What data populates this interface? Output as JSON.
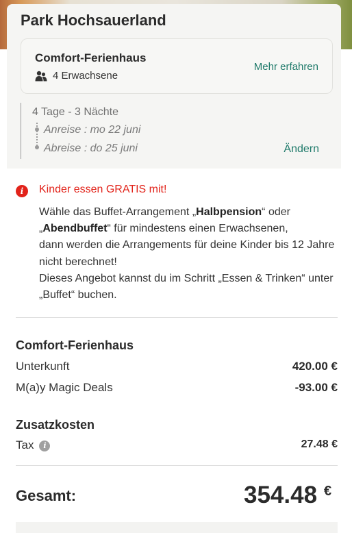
{
  "park": {
    "title": "Park Hochsauerland"
  },
  "accommodation": {
    "name": "Comfort-Ferienhaus",
    "guests": "4 Erwachsene",
    "more_link": "Mehr erfahren"
  },
  "stay": {
    "duration": "4 Tage - 3 Nächte",
    "arrival": "Anreise : mo 22 juni",
    "departure": "Abreise : do 25 juni",
    "change_link": "Ändern"
  },
  "notice": {
    "title": "Kinder essen GRATIS mit!",
    "line1_pre": "Wähle das Buffet-Arrangement „",
    "halbpension": "Halbpension",
    "line1_post": "“ oder",
    "line2_pre": "„",
    "abendbuffet": "Abendbuffet",
    "line2_post": "“ für mindestens einen Erwachsenen,",
    "line3": "dann werden die Arrangements für deine Kinder bis 12 Jahre nicht berechnet!",
    "line4": "Dieses Angebot kannst du im Schritt „Essen & Trinken“ unter „Buffet“ buchen."
  },
  "summary": {
    "section_title": "Comfort-Ferienhaus",
    "items": [
      {
        "label": "Unterkunft",
        "value": "420.00 €"
      },
      {
        "label": "M(a)y Magic Deals",
        "value": "-93.00 €"
      }
    ],
    "extra_title": "Zusatzkosten",
    "tax_label": "Tax",
    "tax_value": "27.48 €",
    "total_label": "Gesamt:",
    "total_value": "354.48",
    "total_currency": "€"
  },
  "colors": {
    "accent_link": "#1f7a6a",
    "alert_red": "#e2231a"
  },
  "icons": [
    "people-icon",
    "info-alert-icon",
    "info-icon"
  ]
}
